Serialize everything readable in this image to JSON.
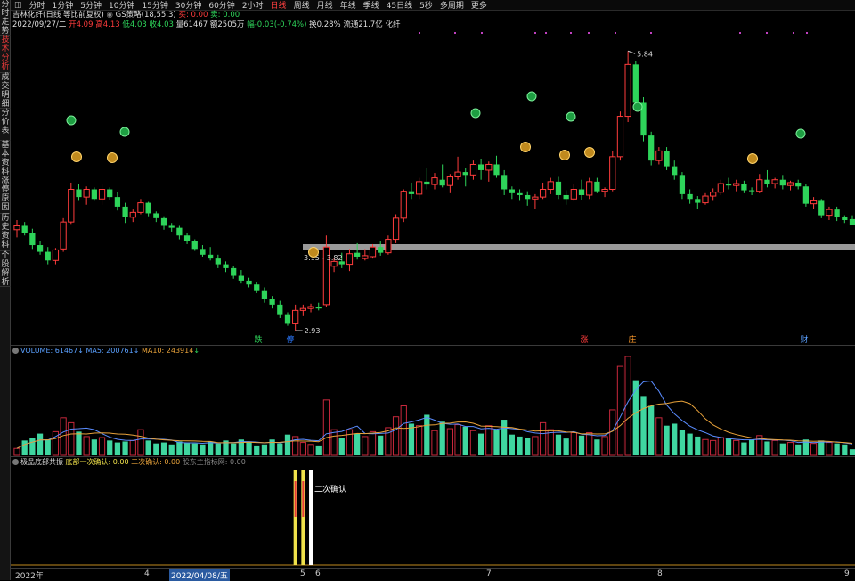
{
  "sidebar": {
    "tabs": [
      "分时走势",
      "技术分析",
      "成交明细",
      "分价表",
      "基本资料",
      "涨停原因",
      "历史资料",
      "个股解析"
    ],
    "active_index": 1
  },
  "periodbar": {
    "items": [
      "分时",
      "1分钟",
      "5分钟",
      "10分钟",
      "15分钟",
      "30分钟",
      "60分钟",
      "2小时",
      "日线",
      "周线",
      "月线",
      "年线",
      "季线",
      "45日线",
      "5秒",
      "多周期",
      "更多"
    ],
    "active": "日线"
  },
  "header": {
    "stock": "吉林化纤(日线 等比前复权)",
    "strategy": "GS策略(18,55,3)",
    "buy_label": "买: 0.00",
    "sell_label": "卖: 0.00",
    "date": "2022/09/27/二",
    "open": "开4.09",
    "high": "高4.13",
    "low": "低4.03",
    "close": "收4.03",
    "volume": "量61467",
    "amount": "额2505万",
    "change": "幅-0.03(-0.74%)",
    "turnover": "换0.28%",
    "float_cap": "流通21.7亿",
    "sector": "化纤"
  },
  "annotations": {
    "high": "5.84",
    "low": "2.93",
    "range": "3.15 - 3.82"
  },
  "events": [
    "跌",
    "停",
    "涨",
    "庄",
    "财"
  ],
  "volume_panel": {
    "label": "VOLUME:",
    "volume": "61467",
    "ma5_label": "MA5:",
    "ma5": "200761",
    "ma10_label": "MA10:",
    "ma10": "243914"
  },
  "indicator_panel": {
    "name": "极品底部共振",
    "bottom1": "底部一次确认: 0.00",
    "bottom2": "二次确认: 0.00",
    "main_force": "股东主指标网: 0.00",
    "signal_label": "二次确认"
  },
  "date_axis": {
    "year": "2022年",
    "months": [
      "4",
      "5",
      "6",
      "7",
      "8",
      "9"
    ],
    "selected": "2022/04/08/五"
  },
  "colors": {
    "up": "#ff3c3c",
    "down": "#2ed45a",
    "ma5": "#5a8cff",
    "ma10": "#e8a23a",
    "vol_down": "#3fd6a0",
    "vol_up": "#c8283c",
    "yellow": "#f0e14a"
  },
  "chart_data": {
    "type": "candlestick",
    "ohlc": [
      [
        3.98,
        4.08,
        3.9,
        4.02
      ],
      [
        4.02,
        4.06,
        3.92,
        3.95
      ],
      [
        3.95,
        3.99,
        3.78,
        3.82
      ],
      [
        3.82,
        3.86,
        3.72,
        3.75
      ],
      [
        3.75,
        3.8,
        3.62,
        3.66
      ],
      [
        3.66,
        3.79,
        3.62,
        3.77
      ],
      [
        3.78,
        4.1,
        3.75,
        4.06
      ],
      [
        4.06,
        4.47,
        4.04,
        4.4
      ],
      [
        4.4,
        4.46,
        4.28,
        4.32
      ],
      [
        4.32,
        4.43,
        4.24,
        4.4
      ],
      [
        4.4,
        4.42,
        4.28,
        4.3
      ],
      [
        4.3,
        4.46,
        4.24,
        4.4
      ],
      [
        4.4,
        4.42,
        4.29,
        4.32
      ],
      [
        4.32,
        4.37,
        4.18,
        4.22
      ],
      [
        4.22,
        4.26,
        4.05,
        4.11
      ],
      [
        4.11,
        4.19,
        4.06,
        4.16
      ],
      [
        4.16,
        4.3,
        4.14,
        4.26
      ],
      [
        4.26,
        4.27,
        4.12,
        4.15
      ],
      [
        4.15,
        4.17,
        4.06,
        4.1
      ],
      [
        4.1,
        4.12,
        3.98,
        4.02
      ],
      [
        4.02,
        4.05,
        3.96,
        4.0
      ],
      [
        4.0,
        4.02,
        3.88,
        3.92
      ],
      [
        3.92,
        3.95,
        3.83,
        3.86
      ],
      [
        3.86,
        3.88,
        3.76,
        3.78
      ],
      [
        3.78,
        3.82,
        3.7,
        3.72
      ],
      [
        3.72,
        3.8,
        3.66,
        3.68
      ],
      [
        3.68,
        3.72,
        3.58,
        3.62
      ],
      [
        3.62,
        3.65,
        3.54,
        3.58
      ],
      [
        3.58,
        3.6,
        3.47,
        3.5
      ],
      [
        3.5,
        3.56,
        3.42,
        3.45
      ],
      [
        3.45,
        3.48,
        3.38,
        3.41
      ],
      [
        3.41,
        3.43,
        3.32,
        3.35
      ],
      [
        3.35,
        3.38,
        3.22,
        3.26
      ],
      [
        3.26,
        3.29,
        3.16,
        3.2
      ],
      [
        3.2,
        3.24,
        3.06,
        3.1
      ],
      [
        3.1,
        3.12,
        2.98,
        3.0
      ],
      [
        3.0,
        3.2,
        2.93,
        3.14
      ],
      [
        3.14,
        3.2,
        3.08,
        3.16
      ],
      [
        3.16,
        3.21,
        3.12,
        3.18
      ],
      [
        3.18,
        3.22,
        3.14,
        3.16
      ],
      [
        3.2,
        3.92,
        3.18,
        3.8
      ],
      [
        3.6,
        3.69,
        3.54,
        3.65
      ],
      [
        3.65,
        3.74,
        3.58,
        3.62
      ],
      [
        3.62,
        3.78,
        3.55,
        3.73
      ],
      [
        3.74,
        3.84,
        3.67,
        3.7
      ],
      [
        3.68,
        3.78,
        3.66,
        3.71
      ],
      [
        3.7,
        3.83,
        3.68,
        3.8
      ],
      [
        3.8,
        3.86,
        3.71,
        3.74
      ],
      [
        3.74,
        3.92,
        3.72,
        3.88
      ],
      [
        3.88,
        4.14,
        3.84,
        4.1
      ],
      [
        4.1,
        4.4,
        4.06,
        4.38
      ],
      [
        4.38,
        4.47,
        4.3,
        4.35
      ],
      [
        4.35,
        4.52,
        4.3,
        4.48
      ],
      [
        4.48,
        4.62,
        4.4,
        4.45
      ],
      [
        4.45,
        4.57,
        4.4,
        4.52
      ],
      [
        4.5,
        4.66,
        4.42,
        4.44
      ],
      [
        4.44,
        4.56,
        4.36,
        4.53
      ],
      [
        4.53,
        4.74,
        4.5,
        4.58
      ],
      [
        4.58,
        4.62,
        4.43,
        4.55
      ],
      [
        4.55,
        4.7,
        4.5,
        4.66
      ],
      [
        4.66,
        4.72,
        4.5,
        4.6
      ],
      [
        4.6,
        4.69,
        4.48,
        4.66
      ],
      [
        4.66,
        4.75,
        4.52,
        4.55
      ],
      [
        4.55,
        4.6,
        4.34,
        4.4
      ],
      [
        4.4,
        4.43,
        4.3,
        4.36
      ],
      [
        4.36,
        4.4,
        4.28,
        4.34
      ],
      [
        4.34,
        4.38,
        4.23,
        4.3
      ],
      [
        4.3,
        4.35,
        4.2,
        4.32
      ],
      [
        4.32,
        4.47,
        4.3,
        4.4
      ],
      [
        4.4,
        4.52,
        4.35,
        4.48
      ],
      [
        4.48,
        4.53,
        4.3,
        4.34
      ],
      [
        4.34,
        4.39,
        4.24,
        4.3
      ],
      [
        4.3,
        4.45,
        4.28,
        4.4
      ],
      [
        4.4,
        4.5,
        4.29,
        4.34
      ],
      [
        4.34,
        4.52,
        4.3,
        4.48
      ],
      [
        4.48,
        4.52,
        4.36,
        4.38
      ],
      [
        4.38,
        4.42,
        4.32,
        4.4
      ],
      [
        4.4,
        4.8,
        4.38,
        4.74
      ],
      [
        4.74,
        5.21,
        4.7,
        5.16
      ],
      [
        5.16,
        5.84,
        5.1,
        5.7
      ],
      [
        5.7,
        5.74,
        5.24,
        5.3
      ],
      [
        5.3,
        5.36,
        4.9,
        4.96
      ],
      [
        4.96,
        5.0,
        4.65,
        4.7
      ],
      [
        4.7,
        4.84,
        4.66,
        4.8
      ],
      [
        4.8,
        4.84,
        4.6,
        4.64
      ],
      [
        4.64,
        4.7,
        4.5,
        4.55
      ],
      [
        4.55,
        4.58,
        4.3,
        4.35
      ],
      [
        4.35,
        4.4,
        4.25,
        4.3
      ],
      [
        4.3,
        4.33,
        4.2,
        4.26
      ],
      [
        4.26,
        4.36,
        4.24,
        4.33
      ],
      [
        4.33,
        4.41,
        4.28,
        4.37
      ],
      [
        4.37,
        4.5,
        4.34,
        4.46
      ],
      [
        4.46,
        4.52,
        4.4,
        4.44
      ],
      [
        4.44,
        4.5,
        4.38,
        4.46
      ],
      [
        4.46,
        4.49,
        4.36,
        4.39
      ],
      [
        4.39,
        4.42,
        4.34,
        4.38
      ],
      [
        4.38,
        4.56,
        4.36,
        4.5
      ],
      [
        4.5,
        4.6,
        4.42,
        4.46
      ],
      [
        4.46,
        4.52,
        4.41,
        4.5
      ],
      [
        4.5,
        4.55,
        4.4,
        4.44
      ],
      [
        4.44,
        4.49,
        4.39,
        4.47
      ],
      [
        4.47,
        4.5,
        4.4,
        4.43
      ],
      [
        4.43,
        4.46,
        4.22,
        4.25
      ],
      [
        4.25,
        4.32,
        4.2,
        4.28
      ],
      [
        4.28,
        4.3,
        4.1,
        4.13
      ],
      [
        4.13,
        4.22,
        4.08,
        4.19
      ],
      [
        4.19,
        4.22,
        4.07,
        4.11
      ],
      [
        4.11,
        4.13,
        4.05,
        4.08
      ],
      [
        4.09,
        4.13,
        4.03,
        4.03
      ]
    ],
    "volume": [
      70000,
      150000,
      180000,
      220000,
      160000,
      240000,
      380000,
      330000,
      240000,
      190000,
      160000,
      180000,
      150000,
      130000,
      140000,
      150000,
      260000,
      150000,
      120000,
      130000,
      110000,
      140000,
      130000,
      120000,
      110000,
      140000,
      120000,
      150000,
      120000,
      160000,
      140000,
      100000,
      110000,
      160000,
      120000,
      210000,
      190000,
      130000,
      110000,
      100000,
      560000,
      260000,
      180000,
      260000,
      220000,
      190000,
      240000,
      200000,
      280000,
      390000,
      500000,
      320000,
      300000,
      410000,
      250000,
      340000,
      270000,
      310000,
      290000,
      250000,
      220000,
      300000,
      260000,
      360000,
      210000,
      190000,
      180000,
      190000,
      330000,
      260000,
      210000,
      170000,
      230000,
      200000,
      230000,
      160000,
      190000,
      460000,
      900000,
      1000000,
      760000,
      600000,
      500000,
      380000,
      300000,
      320000,
      260000,
      220000,
      190000,
      160000,
      150000,
      180000,
      170000,
      150000,
      130000,
      160000,
      200000,
      140000,
      150000,
      120000,
      130000,
      110000,
      160000,
      120000,
      150000,
      130000,
      120000,
      110000,
      61467
    ],
    "indicator_signals": [
      36,
      37,
      38
    ],
    "ylim": [
      2.8,
      6.0
    ]
  }
}
